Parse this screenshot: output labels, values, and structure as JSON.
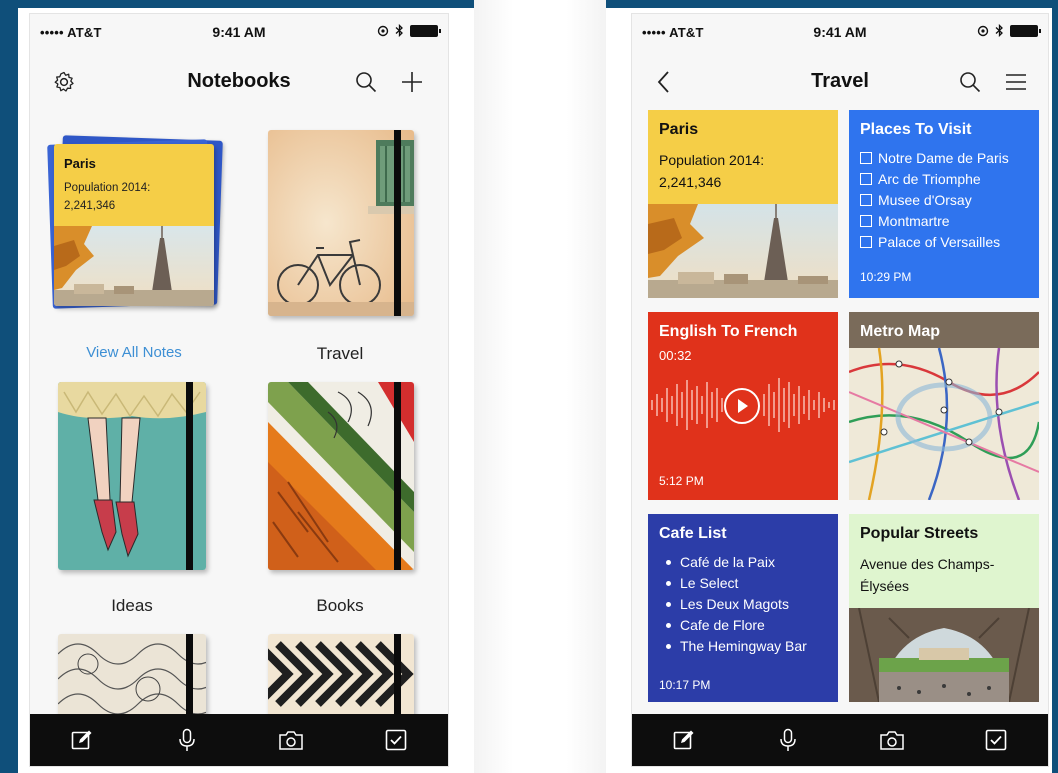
{
  "status_bar": {
    "carrier": "••••• AT&T",
    "time": "9:41 AM"
  },
  "notebooks_screen": {
    "title": "Notebooks",
    "paris_note": {
      "title": "Paris",
      "body_line1": "Population 2014:",
      "body_line2": "2,241,346"
    },
    "notebooks": [
      {
        "label": "View All Notes"
      },
      {
        "label": "Travel"
      },
      {
        "label": "Ideas"
      },
      {
        "label": "Books"
      }
    ]
  },
  "travel_screen": {
    "title": "Travel",
    "paris_card": {
      "title": "Paris",
      "line1": "Population 2014:",
      "line2": "2,241,346"
    },
    "places_card": {
      "title": "Places To Visit",
      "items": [
        "Notre Dame de Paris",
        "Arc de Triomphe",
        "Musee d'Orsay",
        "Montmartre",
        "Palace of Versailles"
      ],
      "time": "10:29 PM"
    },
    "audio_card": {
      "title": "English To French",
      "duration": "00:32",
      "time": "5:12 PM"
    },
    "map_card": {
      "title": "Metro Map"
    },
    "cafe_card": {
      "title": "Cafe List",
      "items": [
        "Café de la Paix",
        "Le Select",
        "Les Deux Magots",
        "Cafe de Flore",
        "The Hemingway Bar"
      ],
      "time": "10:17 PM"
    },
    "streets_card": {
      "title": "Popular Streets",
      "line1": "Avenue des Champs-",
      "line2": "Élysées"
    }
  },
  "colors": {
    "yellow": "#f5ce47",
    "blue": "#2f74ee",
    "red": "#e0321b",
    "navy": "#2c3da8",
    "mint": "#dff5cf",
    "link": "#3d8fd4"
  },
  "icons": {
    "tab_bar": [
      "compose-icon",
      "microphone-icon",
      "camera-icon",
      "checkbox-icon"
    ],
    "left_nav": [
      "gear-icon",
      "search-icon",
      "plus-icon"
    ],
    "right_nav": [
      "back-chevron-icon",
      "search-icon",
      "menu-icon"
    ]
  }
}
